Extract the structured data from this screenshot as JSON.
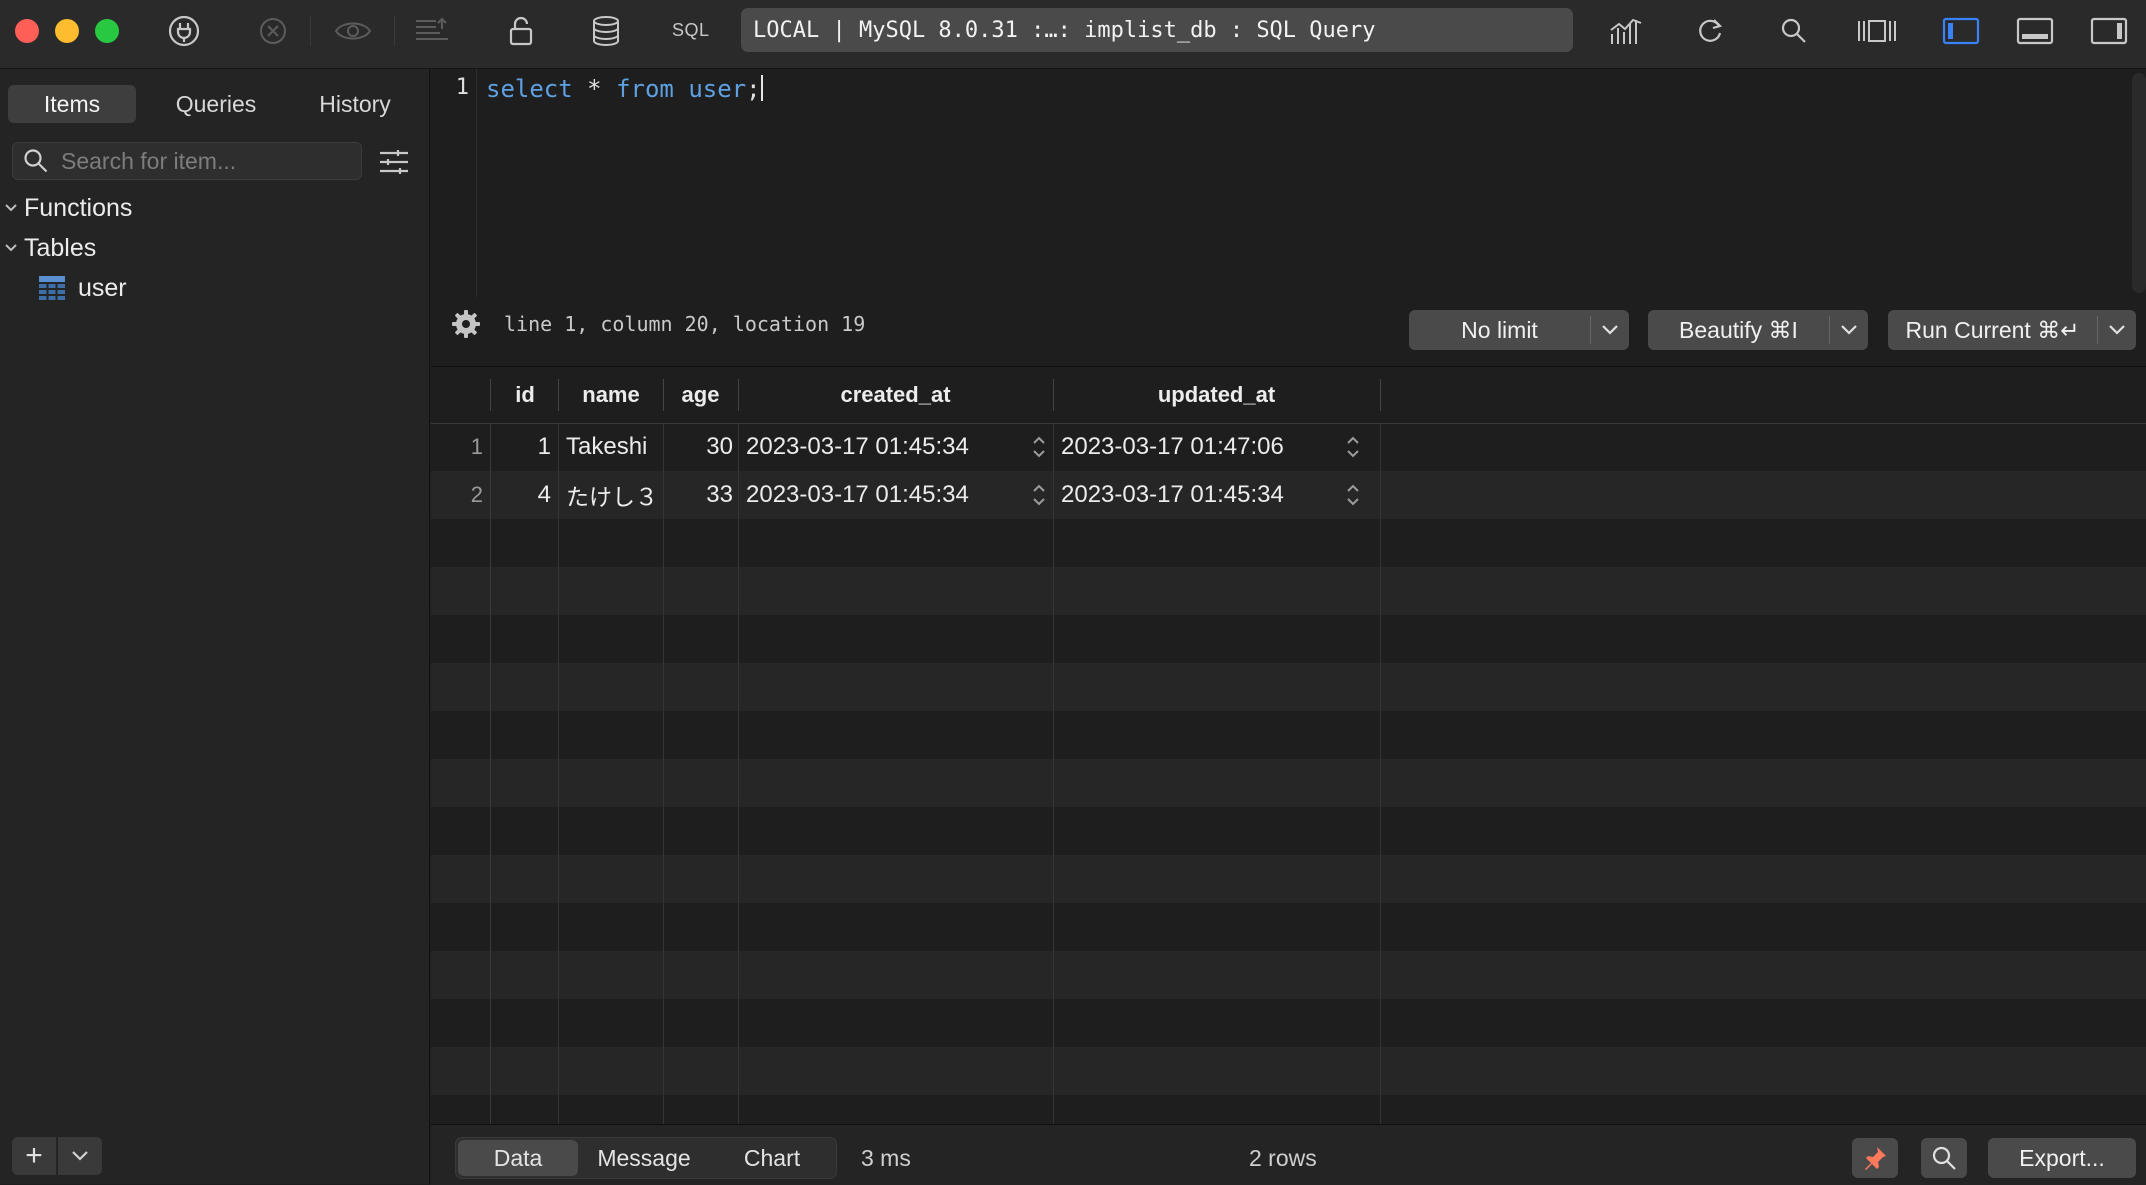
{
  "toolbar": {
    "sql_label": "SQL",
    "connection_title": "LOCAL | MySQL 8.0.31 :…: implist_db : SQL Query",
    "colors": {
      "close": "#ff5f57",
      "minimize": "#febc2e",
      "zoom": "#28c840",
      "accent": "#3a82f7"
    }
  },
  "sidebar": {
    "tabs": [
      {
        "label": "Items",
        "active": true
      },
      {
        "label": "Queries",
        "active": false
      },
      {
        "label": "History",
        "active": false
      }
    ],
    "search_placeholder": "Search for item...",
    "tree": {
      "functions_label": "Functions",
      "tables_label": "Tables",
      "table_user": "user"
    },
    "add_label": "+"
  },
  "editor": {
    "line_number": "1",
    "tokens": {
      "select": "select",
      "star": " * ",
      "from": "from",
      "space": " ",
      "table": "user",
      "semicolon": ";"
    },
    "status": "line 1, column 20, location 19",
    "limit_label": "No limit",
    "beautify_label": "Beautify ⌘I",
    "run_label": "Run Current ⌘↵"
  },
  "results": {
    "columns": [
      "id",
      "name",
      "age",
      "created_at",
      "updated_at"
    ],
    "rows": [
      {
        "num": "1",
        "id": "1",
        "name": "Takeshi",
        "age": "30",
        "created_at": "2023-03-17 01:45:34",
        "updated_at": "2023-03-17 01:47:06"
      },
      {
        "num": "2",
        "id": "4",
        "name": "たけし３",
        "age": "33",
        "created_at": "2023-03-17 01:45:34",
        "updated_at": "2023-03-17 01:45:34"
      }
    ]
  },
  "bottom": {
    "tabs": [
      {
        "label": "Data",
        "active": true
      },
      {
        "label": "Message",
        "active": false
      },
      {
        "label": "Chart",
        "active": false
      }
    ],
    "duration": "3 ms",
    "row_count": "2 rows",
    "export_label": "Export..."
  }
}
